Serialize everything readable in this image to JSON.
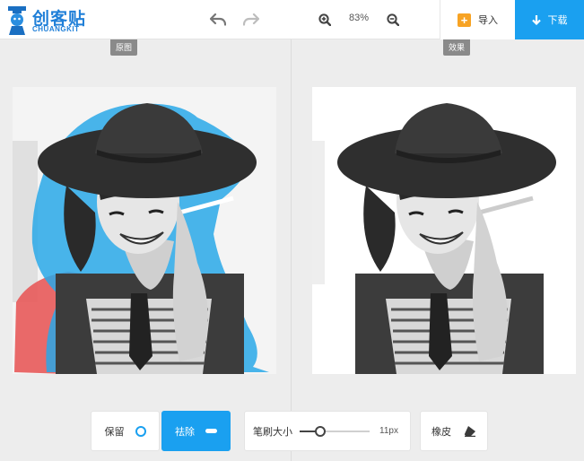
{
  "app": {
    "logo_text": "创客贴",
    "logo_sub": "CHUANGKIT"
  },
  "toolbar": {
    "zoom_level": "83%",
    "import_label": "导入",
    "import_icon": "plus-icon",
    "download_label": "下载",
    "download_icon": "download-arrow-icon"
  },
  "panels": {
    "original_tag": "原图",
    "result_tag": "效果"
  },
  "bottom_tools": {
    "keep_label": "保留",
    "remove_label": "祛除",
    "brush_size_label": "笔刷大小",
    "brush_size_value": "11px",
    "brush_slider_level": 0.29,
    "eraser_label": "橡皮"
  },
  "colors": {
    "accent": "#1aa0f0",
    "keep_stroke": "#29a8e8",
    "remove_stroke": "#e85a5a",
    "import_icon": "#f7a324"
  }
}
